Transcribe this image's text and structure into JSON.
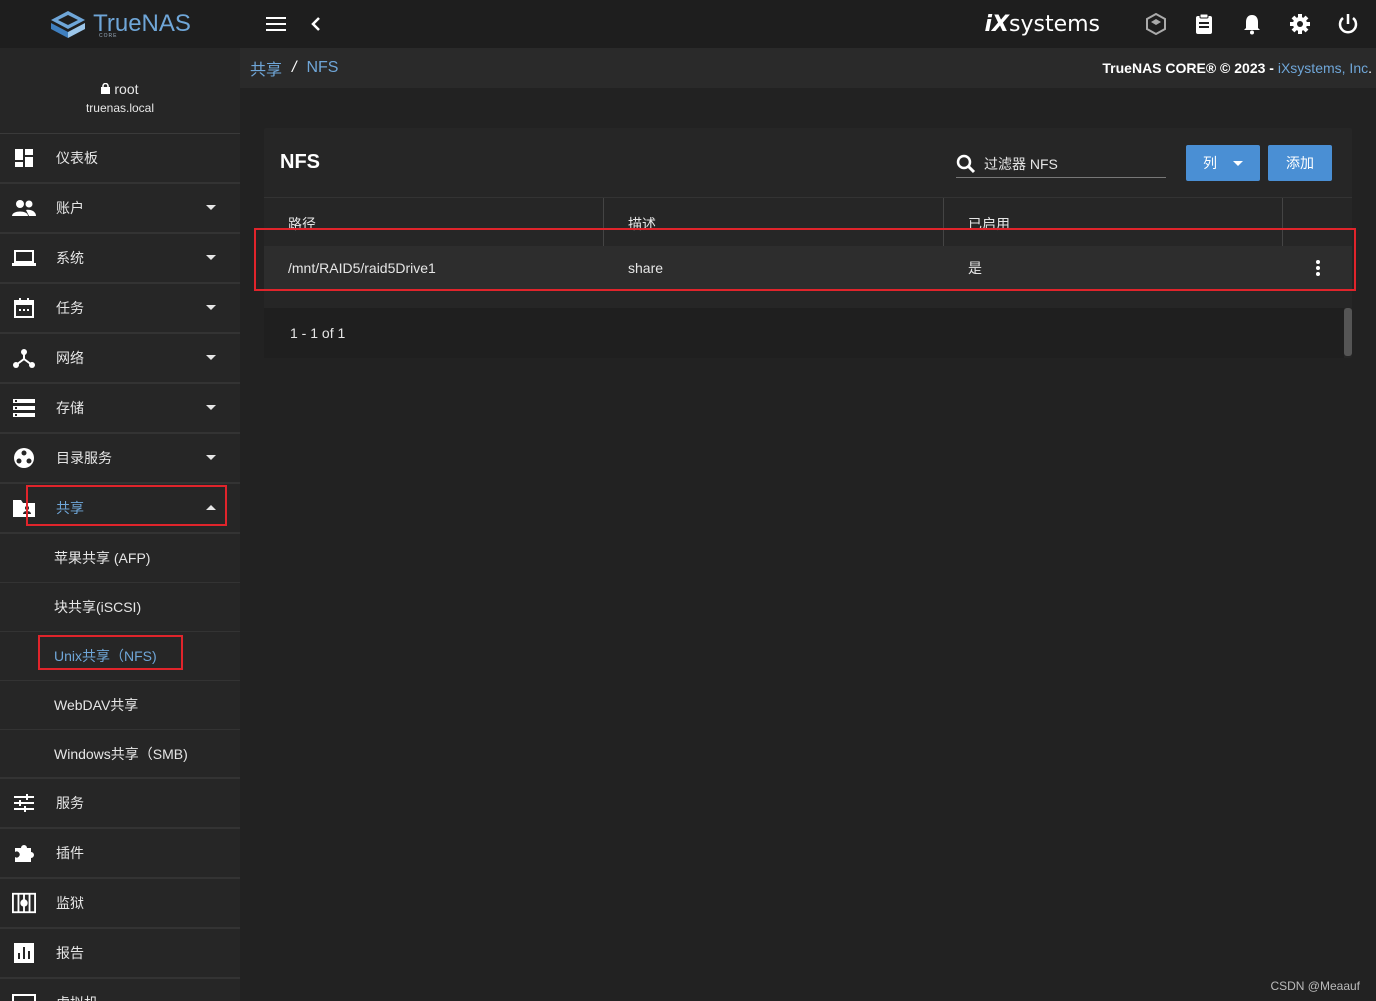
{
  "brand": {
    "name": "TrueNAS",
    "sub": "CORE"
  },
  "topbar": {
    "vendor_prefix": "iX",
    "vendor_suffix": "systems"
  },
  "user": {
    "name": "root",
    "host": "truenas.local"
  },
  "sidebar": {
    "items": [
      {
        "label": "仪表板"
      },
      {
        "label": "账户"
      },
      {
        "label": "系统"
      },
      {
        "label": "任务"
      },
      {
        "label": "网络"
      },
      {
        "label": "存储"
      },
      {
        "label": "目录服务"
      },
      {
        "label": "共享"
      },
      {
        "label": "服务"
      },
      {
        "label": "插件"
      },
      {
        "label": "监狱"
      },
      {
        "label": "报告"
      },
      {
        "label": "虚拟机"
      }
    ],
    "sub_items": [
      {
        "label": "苹果共享 (AFP)"
      },
      {
        "label": "块共享(iSCSI)"
      },
      {
        "label": "Unix共享（NFS)"
      },
      {
        "label": "WebDAV共享"
      },
      {
        "label": "Windows共享（SMB)"
      }
    ]
  },
  "breadcrumb": {
    "parent": "共享",
    "separator": "/",
    "current": "NFS"
  },
  "copyright": {
    "text": "TrueNAS CORE® © 2023 - ",
    "company": "iXsystems, Inc",
    "end": "."
  },
  "card": {
    "title": "NFS",
    "filter_placeholder": "过滤器 NFS",
    "columns_button": "列",
    "add_button": "添加",
    "headers": [
      "路径",
      "描述",
      "已启用"
    ],
    "rows": [
      {
        "path": "/mnt/RAID5/raid5Drive1",
        "desc": "share",
        "enabled": "是"
      }
    ],
    "pager": "1 - 1 of 1"
  },
  "watermark": "CSDN @Meaauf",
  "colors": {
    "accent": "#6fa6d8",
    "button": "#4a8fd4",
    "highlight": "#e0242b"
  }
}
